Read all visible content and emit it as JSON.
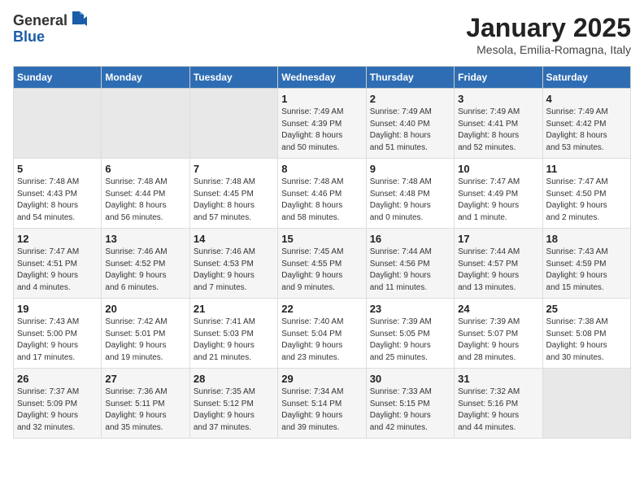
{
  "header": {
    "logo_general": "General",
    "logo_blue": "Blue",
    "title": "January 2025",
    "subtitle": "Mesola, Emilia-Romagna, Italy"
  },
  "weekdays": [
    "Sunday",
    "Monday",
    "Tuesday",
    "Wednesday",
    "Thursday",
    "Friday",
    "Saturday"
  ],
  "weeks": [
    [
      {
        "day": "",
        "info": ""
      },
      {
        "day": "",
        "info": ""
      },
      {
        "day": "",
        "info": ""
      },
      {
        "day": "1",
        "info": "Sunrise: 7:49 AM\nSunset: 4:39 PM\nDaylight: 8 hours\nand 50 minutes."
      },
      {
        "day": "2",
        "info": "Sunrise: 7:49 AM\nSunset: 4:40 PM\nDaylight: 8 hours\nand 51 minutes."
      },
      {
        "day": "3",
        "info": "Sunrise: 7:49 AM\nSunset: 4:41 PM\nDaylight: 8 hours\nand 52 minutes."
      },
      {
        "day": "4",
        "info": "Sunrise: 7:49 AM\nSunset: 4:42 PM\nDaylight: 8 hours\nand 53 minutes."
      }
    ],
    [
      {
        "day": "5",
        "info": "Sunrise: 7:48 AM\nSunset: 4:43 PM\nDaylight: 8 hours\nand 54 minutes."
      },
      {
        "day": "6",
        "info": "Sunrise: 7:48 AM\nSunset: 4:44 PM\nDaylight: 8 hours\nand 56 minutes."
      },
      {
        "day": "7",
        "info": "Sunrise: 7:48 AM\nSunset: 4:45 PM\nDaylight: 8 hours\nand 57 minutes."
      },
      {
        "day": "8",
        "info": "Sunrise: 7:48 AM\nSunset: 4:46 PM\nDaylight: 8 hours\nand 58 minutes."
      },
      {
        "day": "9",
        "info": "Sunrise: 7:48 AM\nSunset: 4:48 PM\nDaylight: 9 hours\nand 0 minutes."
      },
      {
        "day": "10",
        "info": "Sunrise: 7:47 AM\nSunset: 4:49 PM\nDaylight: 9 hours\nand 1 minute."
      },
      {
        "day": "11",
        "info": "Sunrise: 7:47 AM\nSunset: 4:50 PM\nDaylight: 9 hours\nand 2 minutes."
      }
    ],
    [
      {
        "day": "12",
        "info": "Sunrise: 7:47 AM\nSunset: 4:51 PM\nDaylight: 9 hours\nand 4 minutes."
      },
      {
        "day": "13",
        "info": "Sunrise: 7:46 AM\nSunset: 4:52 PM\nDaylight: 9 hours\nand 6 minutes."
      },
      {
        "day": "14",
        "info": "Sunrise: 7:46 AM\nSunset: 4:53 PM\nDaylight: 9 hours\nand 7 minutes."
      },
      {
        "day": "15",
        "info": "Sunrise: 7:45 AM\nSunset: 4:55 PM\nDaylight: 9 hours\nand 9 minutes."
      },
      {
        "day": "16",
        "info": "Sunrise: 7:44 AM\nSunset: 4:56 PM\nDaylight: 9 hours\nand 11 minutes."
      },
      {
        "day": "17",
        "info": "Sunrise: 7:44 AM\nSunset: 4:57 PM\nDaylight: 9 hours\nand 13 minutes."
      },
      {
        "day": "18",
        "info": "Sunrise: 7:43 AM\nSunset: 4:59 PM\nDaylight: 9 hours\nand 15 minutes."
      }
    ],
    [
      {
        "day": "19",
        "info": "Sunrise: 7:43 AM\nSunset: 5:00 PM\nDaylight: 9 hours\nand 17 minutes."
      },
      {
        "day": "20",
        "info": "Sunrise: 7:42 AM\nSunset: 5:01 PM\nDaylight: 9 hours\nand 19 minutes."
      },
      {
        "day": "21",
        "info": "Sunrise: 7:41 AM\nSunset: 5:03 PM\nDaylight: 9 hours\nand 21 minutes."
      },
      {
        "day": "22",
        "info": "Sunrise: 7:40 AM\nSunset: 5:04 PM\nDaylight: 9 hours\nand 23 minutes."
      },
      {
        "day": "23",
        "info": "Sunrise: 7:39 AM\nSunset: 5:05 PM\nDaylight: 9 hours\nand 25 minutes."
      },
      {
        "day": "24",
        "info": "Sunrise: 7:39 AM\nSunset: 5:07 PM\nDaylight: 9 hours\nand 28 minutes."
      },
      {
        "day": "25",
        "info": "Sunrise: 7:38 AM\nSunset: 5:08 PM\nDaylight: 9 hours\nand 30 minutes."
      }
    ],
    [
      {
        "day": "26",
        "info": "Sunrise: 7:37 AM\nSunset: 5:09 PM\nDaylight: 9 hours\nand 32 minutes."
      },
      {
        "day": "27",
        "info": "Sunrise: 7:36 AM\nSunset: 5:11 PM\nDaylight: 9 hours\nand 35 minutes."
      },
      {
        "day": "28",
        "info": "Sunrise: 7:35 AM\nSunset: 5:12 PM\nDaylight: 9 hours\nand 37 minutes."
      },
      {
        "day": "29",
        "info": "Sunrise: 7:34 AM\nSunset: 5:14 PM\nDaylight: 9 hours\nand 39 minutes."
      },
      {
        "day": "30",
        "info": "Sunrise: 7:33 AM\nSunset: 5:15 PM\nDaylight: 9 hours\nand 42 minutes."
      },
      {
        "day": "31",
        "info": "Sunrise: 7:32 AM\nSunset: 5:16 PM\nDaylight: 9 hours\nand 44 minutes."
      },
      {
        "day": "",
        "info": ""
      }
    ]
  ]
}
